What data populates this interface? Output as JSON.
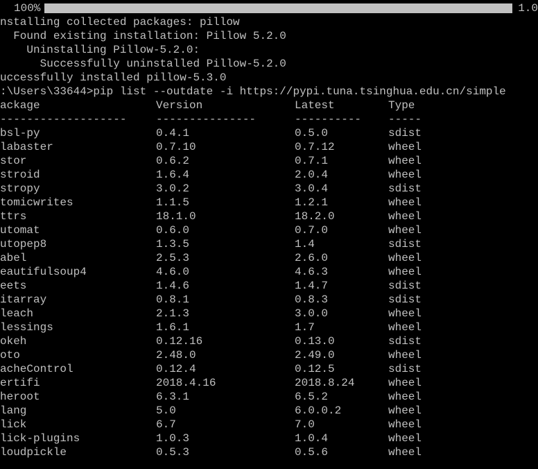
{
  "progress": {
    "percent": "100%",
    "tail": "1.0"
  },
  "install_output": [
    "nstalling collected packages: pillow",
    "  Found existing installation: Pillow 5.2.0",
    "    Uninstalling Pillow-5.2.0:",
    "      Successfully uninstalled Pillow-5.2.0",
    "uccessfully installed pillow-5.3.0",
    ""
  ],
  "prompt": ":\\Users\\33644>pip list --outdate -i https://pypi.tuna.tsinghua.edu.cn/simple",
  "table": {
    "headers": {
      "package": "ackage",
      "version": "Version",
      "latest": "Latest",
      "type": "Type"
    },
    "dashes": {
      "package": "-------------------",
      "version": "---------------",
      "latest": "----------",
      "type": "-----"
    },
    "rows": [
      {
        "package": "bsl-py",
        "version": "0.4.1",
        "latest": "0.5.0",
        "type": "sdist"
      },
      {
        "package": "labaster",
        "version": "0.7.10",
        "latest": "0.7.12",
        "type": "wheel"
      },
      {
        "package": "stor",
        "version": "0.6.2",
        "latest": "0.7.1",
        "type": "wheel"
      },
      {
        "package": "stroid",
        "version": "1.6.4",
        "latest": "2.0.4",
        "type": "wheel"
      },
      {
        "package": "stropy",
        "version": "3.0.2",
        "latest": "3.0.4",
        "type": "sdist"
      },
      {
        "package": "tomicwrites",
        "version": "1.1.5",
        "latest": "1.2.1",
        "type": "wheel"
      },
      {
        "package": "ttrs",
        "version": "18.1.0",
        "latest": "18.2.0",
        "type": "wheel"
      },
      {
        "package": "utomat",
        "version": "0.6.0",
        "latest": "0.7.0",
        "type": "wheel"
      },
      {
        "package": "utopep8",
        "version": "1.3.5",
        "latest": "1.4",
        "type": "sdist"
      },
      {
        "package": "abel",
        "version": "2.5.3",
        "latest": "2.6.0",
        "type": "wheel"
      },
      {
        "package": "eautifulsoup4",
        "version": "4.6.0",
        "latest": "4.6.3",
        "type": "wheel"
      },
      {
        "package": "eets",
        "version": "1.4.6",
        "latest": "1.4.7",
        "type": "sdist"
      },
      {
        "package": "itarray",
        "version": "0.8.1",
        "latest": "0.8.3",
        "type": "sdist"
      },
      {
        "package": "leach",
        "version": "2.1.3",
        "latest": "3.0.0",
        "type": "wheel"
      },
      {
        "package": "lessings",
        "version": "1.6.1",
        "latest": "1.7",
        "type": "wheel"
      },
      {
        "package": "okeh",
        "version": "0.12.16",
        "latest": "0.13.0",
        "type": "sdist"
      },
      {
        "package": "oto",
        "version": "2.48.0",
        "latest": "2.49.0",
        "type": "wheel"
      },
      {
        "package": "acheControl",
        "version": "0.12.4",
        "latest": "0.12.5",
        "type": "sdist"
      },
      {
        "package": "ertifi",
        "version": "2018.4.16",
        "latest": "2018.8.24",
        "type": "wheel"
      },
      {
        "package": "heroot",
        "version": "6.3.1",
        "latest": "6.5.2",
        "type": "wheel"
      },
      {
        "package": "lang",
        "version": "5.0",
        "latest": "6.0.0.2",
        "type": "wheel"
      },
      {
        "package": "lick",
        "version": "6.7",
        "latest": "7.0",
        "type": "wheel"
      },
      {
        "package": "lick-plugins",
        "version": "1.0.3",
        "latest": "1.0.4",
        "type": "wheel"
      },
      {
        "package": "loudpickle",
        "version": "0.5.3",
        "latest": "0.5.6",
        "type": "wheel"
      }
    ]
  }
}
